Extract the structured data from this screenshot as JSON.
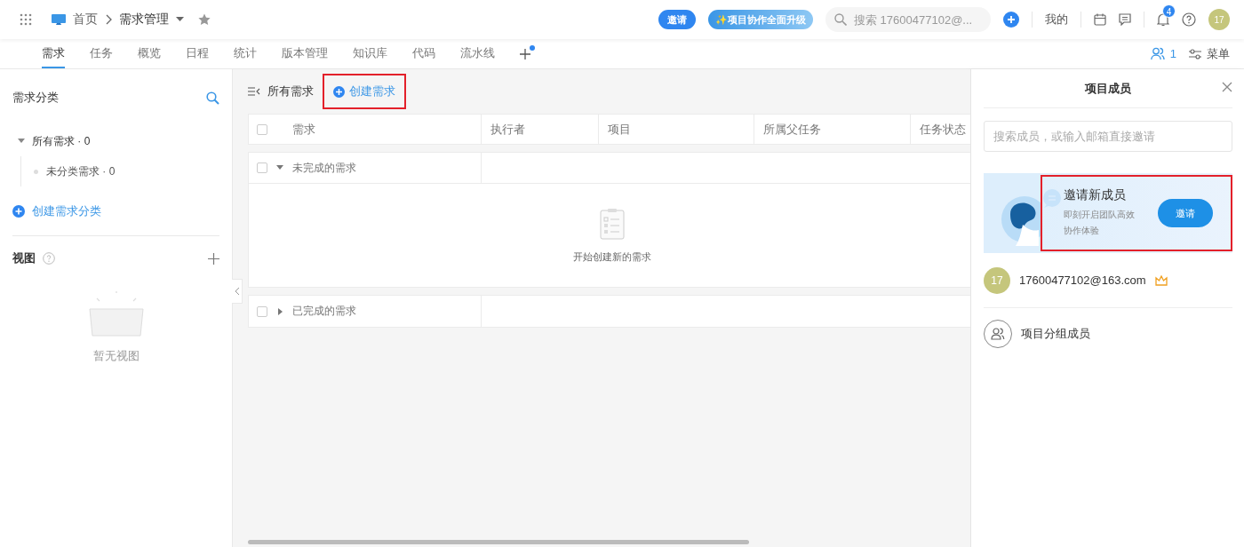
{
  "header": {
    "breadcrumb": [
      {
        "label": "首页"
      },
      {
        "label": "需求管理"
      }
    ],
    "invite_button": "邀请",
    "upgrade_button": "✨项目协作全面升级",
    "search": {
      "placeholder": "搜索 17600477102@..."
    },
    "mine": "我的",
    "notification_count": "4",
    "avatar": "17"
  },
  "tabs": [
    {
      "label": "需求",
      "selected": true
    },
    {
      "label": "任务",
      "selected": false
    },
    {
      "label": "概览",
      "selected": false
    },
    {
      "label": "日程",
      "selected": false
    },
    {
      "label": "统计",
      "selected": false
    },
    {
      "label": "版本管理",
      "selected": false
    },
    {
      "label": "知识库",
      "selected": false
    },
    {
      "label": "代码",
      "selected": false
    },
    {
      "label": "流水线",
      "selected": false
    }
  ],
  "member_count": "1",
  "menu": "菜单",
  "sidebar": {
    "title": "需求分类",
    "tree": [
      {
        "label": "所有需求 · 0",
        "expanded": true,
        "children": [
          {
            "label": "未分类需求 · 0"
          }
        ]
      }
    ],
    "create_link": "创建需求分类",
    "views_title": "视图",
    "views_empty": "暂无视图"
  },
  "toolbar": {
    "filter": "所有需求",
    "create_button": {
      "label": "创建需求",
      "highlighted": true
    }
  },
  "table": {
    "columns": [
      "需求",
      "执行者",
      "项目",
      "所属父任务",
      "任务状态"
    ],
    "all_checked": false,
    "groups": [
      {
        "label": "未完成的需求",
        "checked": false,
        "expanded": true,
        "empty_text": "开始创建新的需求"
      },
      {
        "label": "已完成的需求",
        "checked": false,
        "expanded": false
      }
    ]
  },
  "panel": {
    "title": "项目成员",
    "search": {
      "placeholder": "搜索成员，或输入邮箱直接邀请"
    },
    "invite_card": {
      "title": "邀请新成员",
      "text": "即刻开启团队高效协作体验",
      "button": "邀请",
      "highlighted": true
    },
    "members": [
      {
        "avatar": "17",
        "name": "17600477102@163.com",
        "owner": true
      }
    ],
    "group_link": "项目分组成员"
  }
}
